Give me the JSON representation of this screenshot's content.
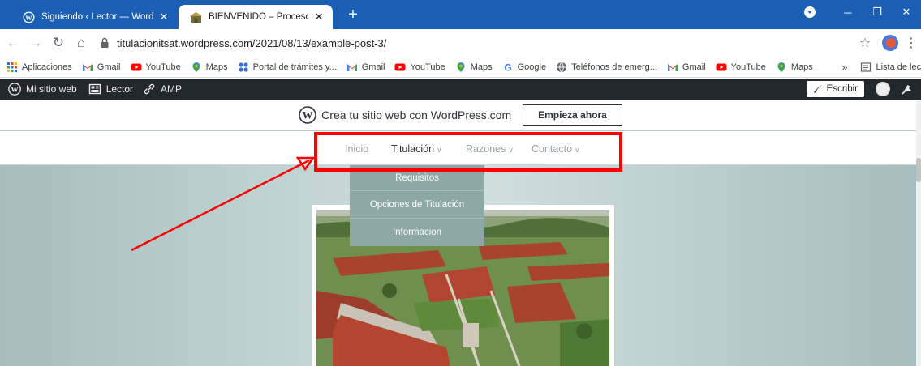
{
  "browser": {
    "tabs": [
      {
        "title": "Siguiendo ‹ Lector — WordPress.",
        "active": false,
        "favicon": "wordpress-icon"
      },
      {
        "title": "BIENVENIDO – Proceso de Titula",
        "active": true,
        "favicon": "school-icon"
      }
    ],
    "address": "titulacionitsat.wordpress.com/2021/08/13/example-post-3/",
    "bookmarks": [
      {
        "label": "Aplicaciones",
        "icon": "apps-grid-icon"
      },
      {
        "label": "Gmail",
        "icon": "gmail-icon"
      },
      {
        "label": "YouTube",
        "icon": "youtube-icon"
      },
      {
        "label": "Maps",
        "icon": "maps-icon"
      },
      {
        "label": "Portal de trámites y...",
        "icon": "portal-icon"
      },
      {
        "label": "Gmail",
        "icon": "gmail-icon"
      },
      {
        "label": "YouTube",
        "icon": "youtube-icon"
      },
      {
        "label": "Maps",
        "icon": "maps-icon"
      },
      {
        "label": "Google",
        "icon": "google-icon"
      },
      {
        "label": "Teléfonos de emerg...",
        "icon": "globe-icon"
      },
      {
        "label": "Gmail",
        "icon": "gmail-icon"
      },
      {
        "label": "YouTube",
        "icon": "youtube-icon"
      },
      {
        "label": "Maps",
        "icon": "maps-icon"
      }
    ],
    "bookmarks_more": "»",
    "reading_list": "Lista de lectura"
  },
  "wp_admin": {
    "site": "Mi sitio web",
    "reader": "Lector",
    "amp": "AMP",
    "write": "Escribir"
  },
  "site": {
    "promo_text": "Crea tu sitio web con WordPress.com",
    "promo_button": "Empieza ahora",
    "nav": [
      {
        "label": "Inicio",
        "has_caret": false,
        "active": false
      },
      {
        "label": "Titulación",
        "has_caret": true,
        "active": true
      },
      {
        "label": "Razones",
        "has_caret": true,
        "active": false
      },
      {
        "label": "Contacto",
        "has_caret": true,
        "active": false
      }
    ],
    "dropdown": [
      "Requisitos",
      "Opciones de Titulación",
      "Informacion"
    ]
  },
  "colors": {
    "chrome_blue": "#1a5fb4",
    "wp_bar": "#23282d",
    "dropdown_bg": "#8ea9a5",
    "annotation_red": "#ff0000"
  }
}
